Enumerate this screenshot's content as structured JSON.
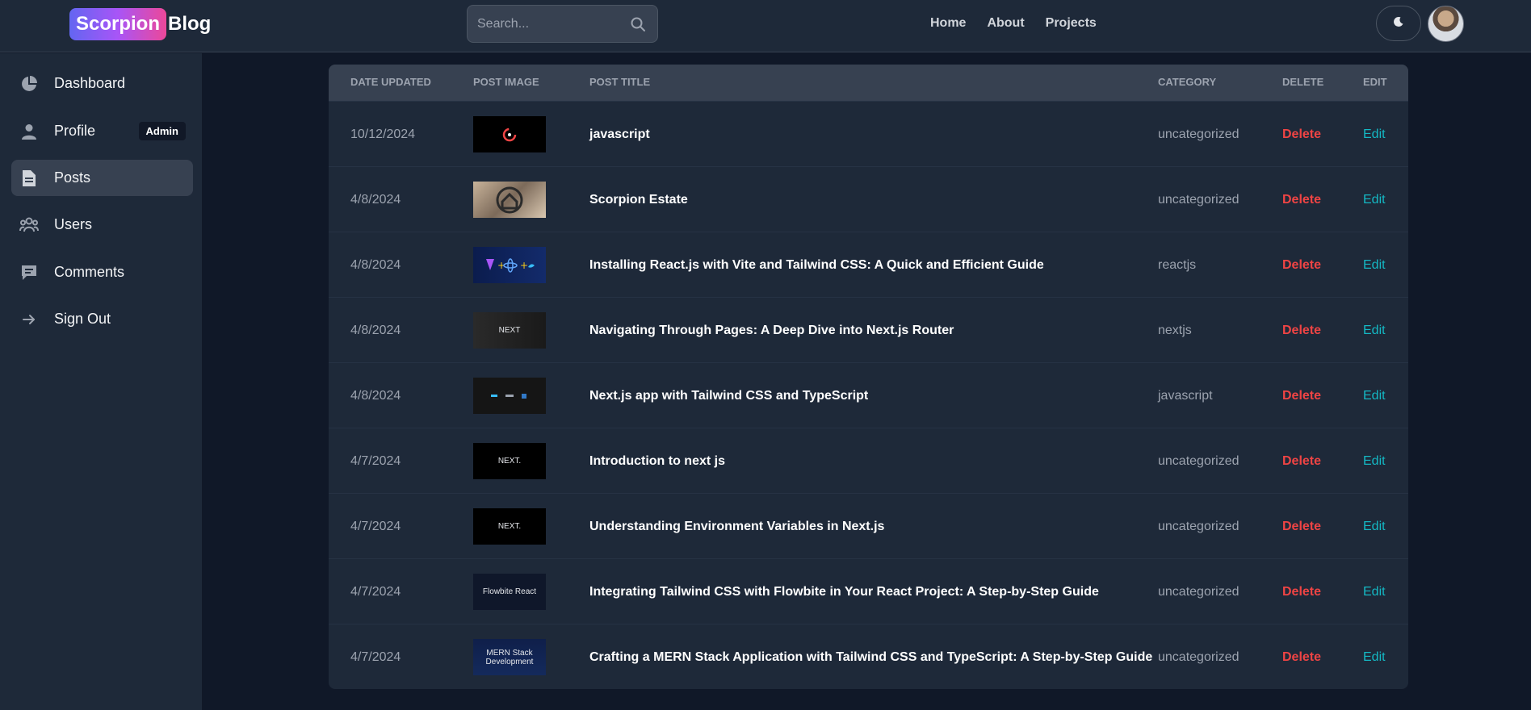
{
  "header": {
    "logo_badge": "Scorpion",
    "logo_text": "Blog",
    "search_placeholder": "Search...",
    "nav": [
      "Home",
      "About",
      "Projects"
    ],
    "theme_icon": "moon-icon"
  },
  "sidebar": {
    "items": [
      {
        "label": "Dashboard",
        "icon": "pie-chart-icon"
      },
      {
        "label": "Profile",
        "icon": "user-icon",
        "badge": "Admin"
      },
      {
        "label": "Posts",
        "icon": "document-icon",
        "active": true
      },
      {
        "label": "Users",
        "icon": "users-icon"
      },
      {
        "label": "Comments",
        "icon": "comment-icon"
      },
      {
        "label": "Sign Out",
        "icon": "arrow-right-icon"
      }
    ]
  },
  "table": {
    "headers": [
      "Date Updated",
      "Post Image",
      "Post Title",
      "Category",
      "Delete",
      "Edit"
    ],
    "rows": [
      {
        "date": "10/12/2024",
        "title": "javascript",
        "category": "uncategorized",
        "delete": "Delete",
        "edit": "Edit",
        "thumb": "logo-red"
      },
      {
        "date": "4/8/2024",
        "title": "Scorpion Estate",
        "category": "uncategorized",
        "delete": "Delete",
        "edit": "Edit",
        "thumb": "estate"
      },
      {
        "date": "4/8/2024",
        "title": "Installing React.js with Vite and Tailwind CSS: A Quick and Efficient Guide",
        "category": "reactjs",
        "delete": "Delete",
        "edit": "Edit",
        "thumb": "react-vite"
      },
      {
        "date": "4/8/2024",
        "title": "Navigating Through Pages: A Deep Dive into Next.js Router",
        "category": "nextjs",
        "delete": "Delete",
        "edit": "Edit",
        "thumb": "next-dark",
        "thumb_text": "NEXT"
      },
      {
        "date": "4/8/2024",
        "title": "Next.js app with Tailwind CSS and TypeScript",
        "category": "javascript",
        "delete": "Delete",
        "edit": "Edit",
        "thumb": "next-ts"
      },
      {
        "date": "4/7/2024",
        "title": "Introduction to next js",
        "category": "uncategorized",
        "delete": "Delete",
        "edit": "Edit",
        "thumb": "next-black",
        "thumb_text": "NEXT."
      },
      {
        "date": "4/7/2024",
        "title": "Understanding Environment Variables in Next.js",
        "category": "uncategorized",
        "delete": "Delete",
        "edit": "Edit",
        "thumb": "next-black",
        "thumb_text": "NEXT."
      },
      {
        "date": "4/7/2024",
        "title": "Integrating Tailwind CSS with Flowbite in Your React Project: A Step-by-Step Guide",
        "category": "uncategorized",
        "delete": "Delete",
        "edit": "Edit",
        "thumb": "flowbite",
        "thumb_text": "Flowbite React"
      },
      {
        "date": "4/7/2024",
        "title": "Crafting a MERN Stack Application with Tailwind CSS and TypeScript: A Step-by-Step Guide",
        "category": "uncategorized",
        "delete": "Delete",
        "edit": "Edit",
        "thumb": "mern",
        "thumb_text": "MERN Stack Development"
      }
    ]
  },
  "colors": {
    "background": "#101828",
    "panel": "#1e2939",
    "delete": "#ef4444",
    "edit": "#14b8c4"
  }
}
